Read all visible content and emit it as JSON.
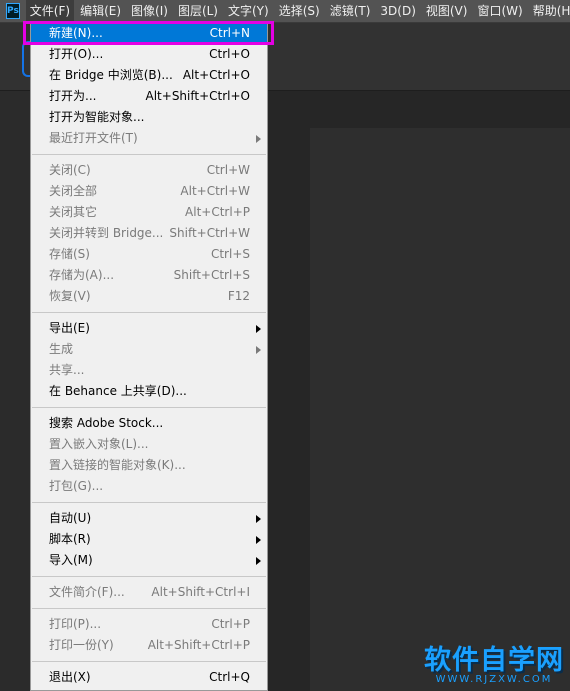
{
  "app": {
    "logo_text": "Ps"
  },
  "menubar": {
    "items": [
      {
        "label": "文件(F)"
      },
      {
        "label": "编辑(E)"
      },
      {
        "label": "图像(I)"
      },
      {
        "label": "图层(L)"
      },
      {
        "label": "文字(Y)"
      },
      {
        "label": "选择(S)"
      },
      {
        "label": "滤镜(T)"
      },
      {
        "label": "3D(D)"
      },
      {
        "label": "视图(V)"
      },
      {
        "label": "窗口(W)"
      },
      {
        "label": "帮助(H)"
      }
    ]
  },
  "file_menu": {
    "groups": [
      [
        {
          "label": "新建(N)...",
          "shortcut": "Ctrl+N",
          "enabled": true,
          "highlighted": true
        },
        {
          "label": "打开(O)...",
          "shortcut": "Ctrl+O",
          "enabled": true
        },
        {
          "label": "在 Bridge 中浏览(B)...",
          "shortcut": "Alt+Ctrl+O",
          "enabled": true
        },
        {
          "label": "打开为...",
          "shortcut": "Alt+Shift+Ctrl+O",
          "enabled": true
        },
        {
          "label": "打开为智能对象...",
          "shortcut": "",
          "enabled": true
        },
        {
          "label": "最近打开文件(T)",
          "shortcut": "",
          "enabled": false,
          "submenu": true
        }
      ],
      [
        {
          "label": "关闭(C)",
          "shortcut": "Ctrl+W",
          "enabled": false
        },
        {
          "label": "关闭全部",
          "shortcut": "Alt+Ctrl+W",
          "enabled": false
        },
        {
          "label": "关闭其它",
          "shortcut": "Alt+Ctrl+P",
          "enabled": false
        },
        {
          "label": "关闭并转到 Bridge...",
          "shortcut": "Shift+Ctrl+W",
          "enabled": false
        },
        {
          "label": "存储(S)",
          "shortcut": "Ctrl+S",
          "enabled": false
        },
        {
          "label": "存储为(A)...",
          "shortcut": "Shift+Ctrl+S",
          "enabled": false
        },
        {
          "label": "恢复(V)",
          "shortcut": "F12",
          "enabled": false
        }
      ],
      [
        {
          "label": "导出(E)",
          "shortcut": "",
          "enabled": true,
          "submenu": true
        },
        {
          "label": "生成",
          "shortcut": "",
          "enabled": false,
          "submenu": true
        },
        {
          "label": "共享...",
          "shortcut": "",
          "enabled": false
        },
        {
          "label": "在 Behance 上共享(D)...",
          "shortcut": "",
          "enabled": true
        }
      ],
      [
        {
          "label": "搜索 Adobe Stock...",
          "shortcut": "",
          "enabled": true
        },
        {
          "label": "置入嵌入对象(L)...",
          "shortcut": "",
          "enabled": false
        },
        {
          "label": "置入链接的智能对象(K)...",
          "shortcut": "",
          "enabled": false
        },
        {
          "label": "打包(G)...",
          "shortcut": "",
          "enabled": false
        }
      ],
      [
        {
          "label": "自动(U)",
          "shortcut": "",
          "enabled": true,
          "submenu": true
        },
        {
          "label": "脚本(R)",
          "shortcut": "",
          "enabled": true,
          "submenu": true
        },
        {
          "label": "导入(M)",
          "shortcut": "",
          "enabled": true,
          "submenu": true
        }
      ],
      [
        {
          "label": "文件简介(F)...",
          "shortcut": "Alt+Shift+Ctrl+I",
          "enabled": false
        }
      ],
      [
        {
          "label": "打印(P)...",
          "shortcut": "Ctrl+P",
          "enabled": false
        },
        {
          "label": "打印一份(Y)",
          "shortcut": "Alt+Shift+Ctrl+P",
          "enabled": false
        }
      ],
      [
        {
          "label": "退出(X)",
          "shortcut": "Ctrl+Q",
          "enabled": true
        }
      ]
    ]
  },
  "watermark": {
    "title": "软件自学网",
    "url": "WWW.RJZXW.COM"
  },
  "colors": {
    "highlight": "#0078d7",
    "annotation_frame": "#e400e4",
    "watermark": "#1aa0ff"
  }
}
